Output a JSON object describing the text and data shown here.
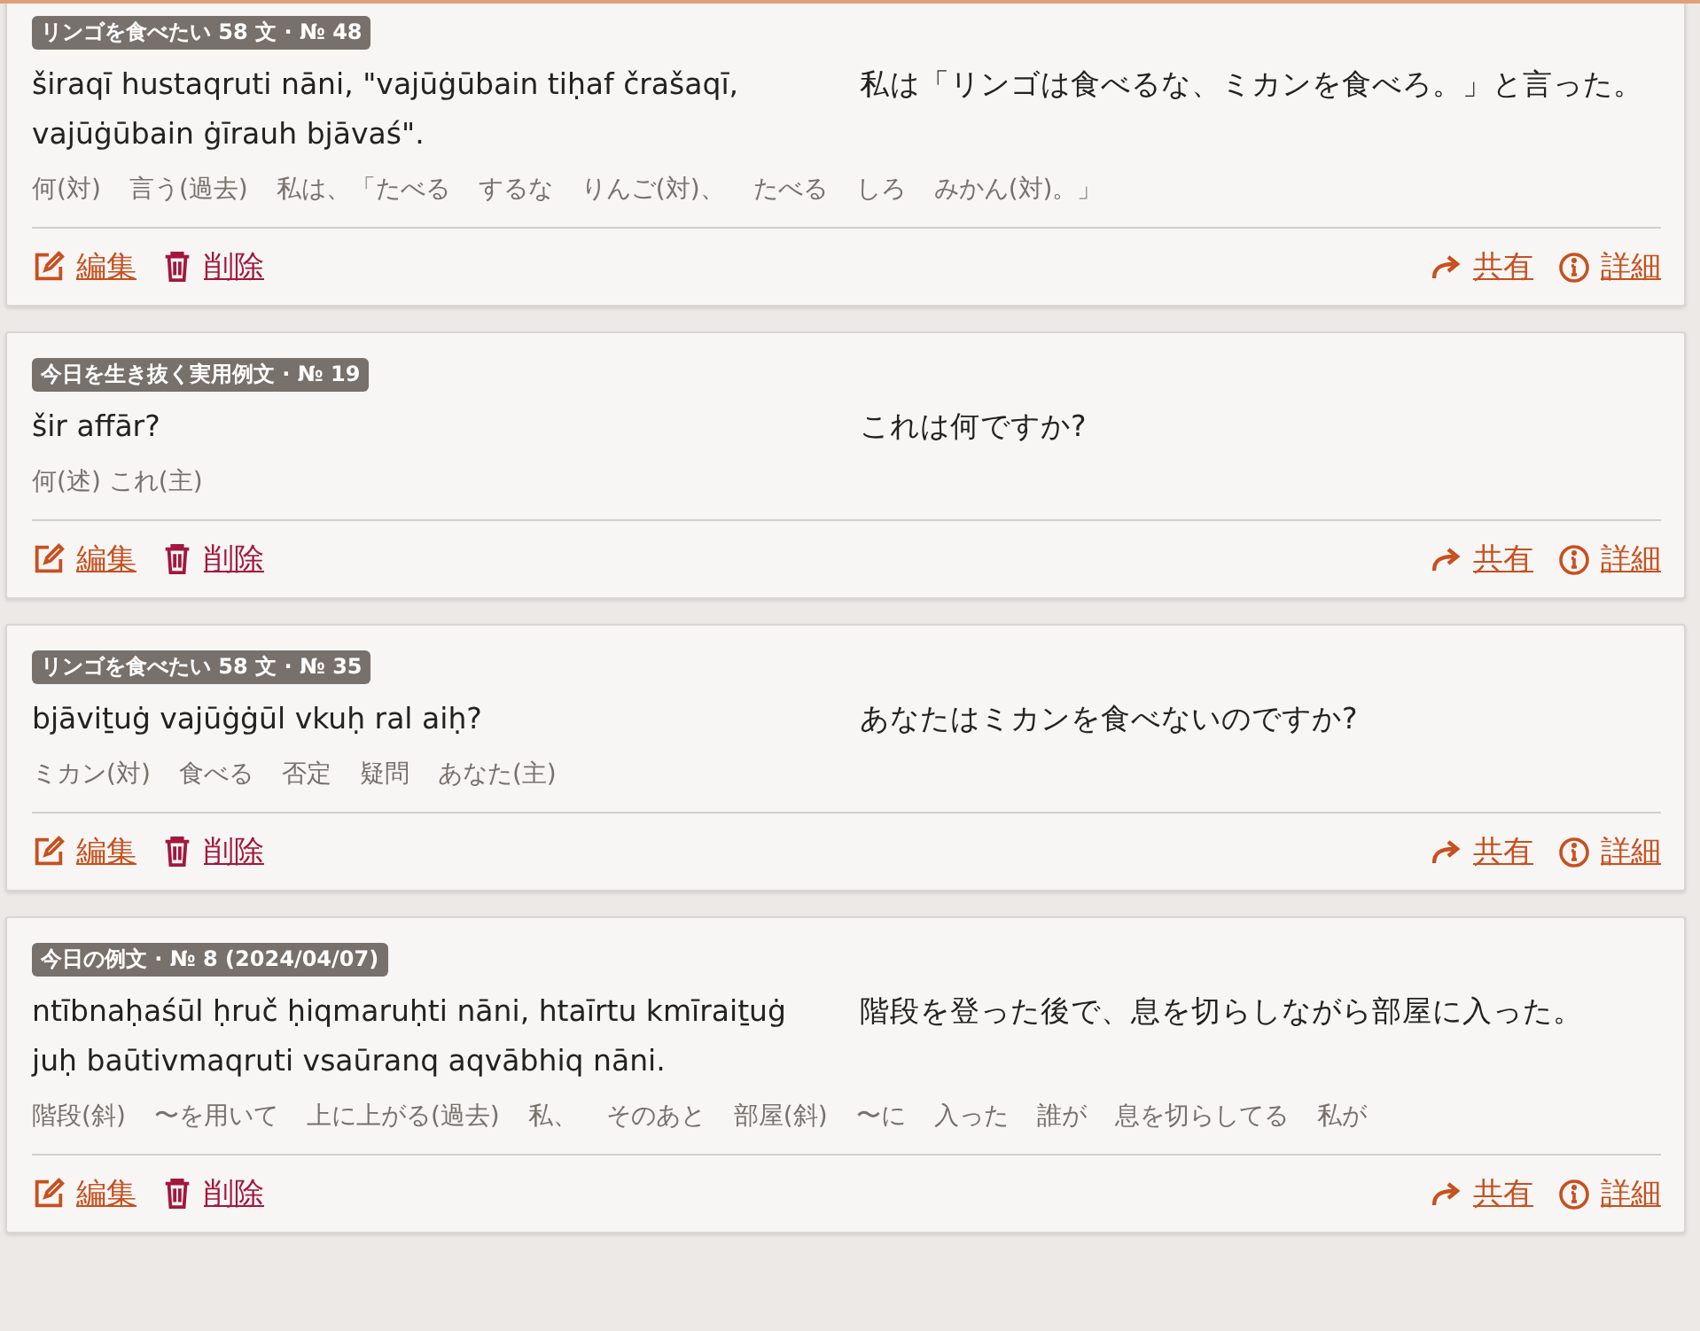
{
  "cards": [
    {
      "badge": "リンゴを食べたい 58 文 · № 48",
      "sentence": "širaqī hustaqruti nāni, \"vajūġūbain tiḥaf črašaqī, vajūġūbain ġīrauh bjāvaś\".",
      "translation": "私は「リンゴは食べるな、ミカンを食べろ。」と言った。",
      "gloss": [
        "何(対)",
        "言う(過去)",
        "私は、「たべる",
        "するな",
        "りんご(対)、",
        "たべる",
        "しろ",
        "みかん(対)。」"
      ],
      "actions_left": [
        "編集",
        "削除"
      ],
      "actions_right": [
        "共有",
        "詳細"
      ]
    },
    {
      "badge": "今日を生き抜く実用例文 · № 19",
      "sentence": "šir affār?",
      "translation": "これは何ですか?",
      "gloss": [
        "何(述) これ(主)"
      ],
      "actions_left": [
        "編集",
        "削除"
      ],
      "actions_right": [
        "共有",
        "詳細"
      ]
    },
    {
      "badge": "リンゴを食べたい 58 文 · № 35",
      "sentence": "bjāviṯuġ vajūġġūl vkuḥ ral aiḥ?",
      "translation": "あなたはミカンを食べないのですか?",
      "gloss": [
        "ミカン(対)",
        "食べる",
        "否定",
        "疑問",
        "あなた(主)"
      ],
      "actions_left": [
        "編集",
        "削除"
      ],
      "actions_right": [
        "共有",
        "詳細"
      ]
    },
    {
      "badge": "今日の例文 · № 8 (2024/04/07)",
      "sentence": "ntībnaḥaśūl ḥruč ḥiqmaruḥti nāni, htaīrtu kmīraiṯuġ juḥ baūtivmaqruti vsaūranq aqvābhiq nāni.",
      "translation": "階段を登った後で、息を切らしながら部屋に入った。",
      "gloss": [
        "階段(斜)",
        "〜を用いて",
        "上に上がる(過去)",
        "私、",
        "そのあと",
        "部屋(斜)",
        "〜に",
        "入った",
        "誰が",
        "息を切らしてる",
        "私が"
      ],
      "actions_left": [
        "編集",
        "削除"
      ],
      "actions_right": [
        "共有",
        "詳細"
      ]
    }
  ]
}
